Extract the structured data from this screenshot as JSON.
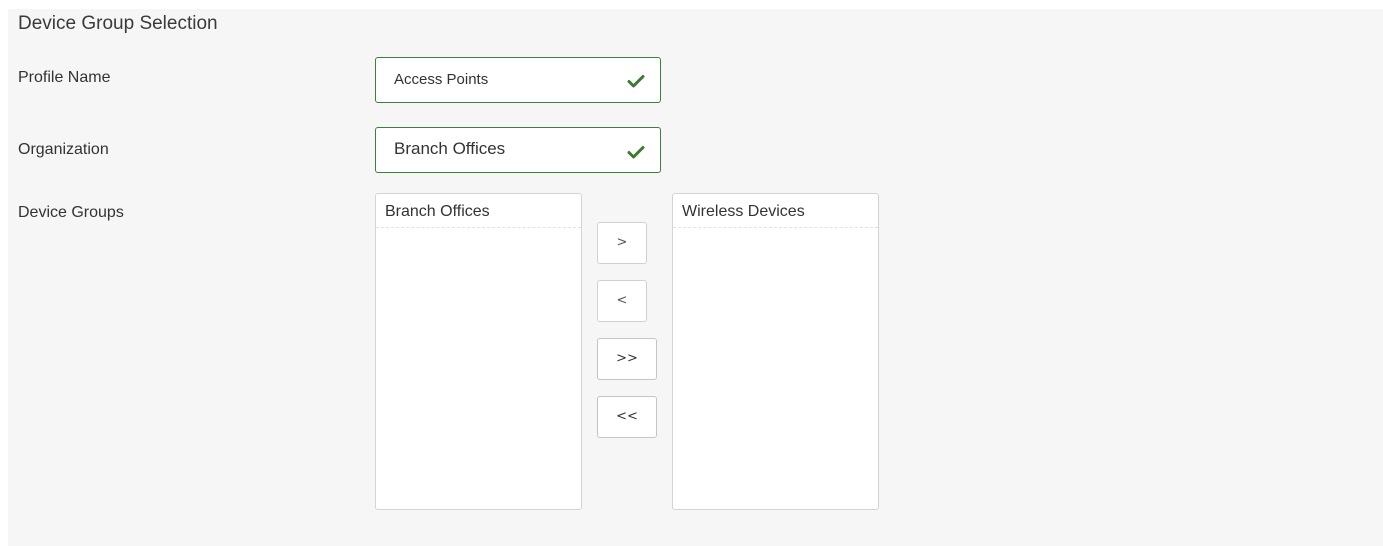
{
  "section": {
    "title": "Device Group Selection"
  },
  "profile": {
    "label": "Profile Name",
    "value": "Access Points",
    "status_icon": "check-icon"
  },
  "organization": {
    "label": "Organization",
    "value": "Branch Offices",
    "status_icon": "check-icon"
  },
  "device_groups": {
    "label": "Device Groups",
    "available_list": {
      "header": "Branch Offices",
      "items": []
    },
    "selected_list": {
      "header": "Wireless Devices",
      "items": []
    },
    "buttons": {
      "move_right": ">",
      "move_left": "<",
      "move_all_right": ">>",
      "move_all_left": "<<"
    }
  },
  "colors": {
    "valid_border": "#3f7e3a",
    "check": "#3c7a32",
    "panel_bg": "#f6f6f6"
  }
}
